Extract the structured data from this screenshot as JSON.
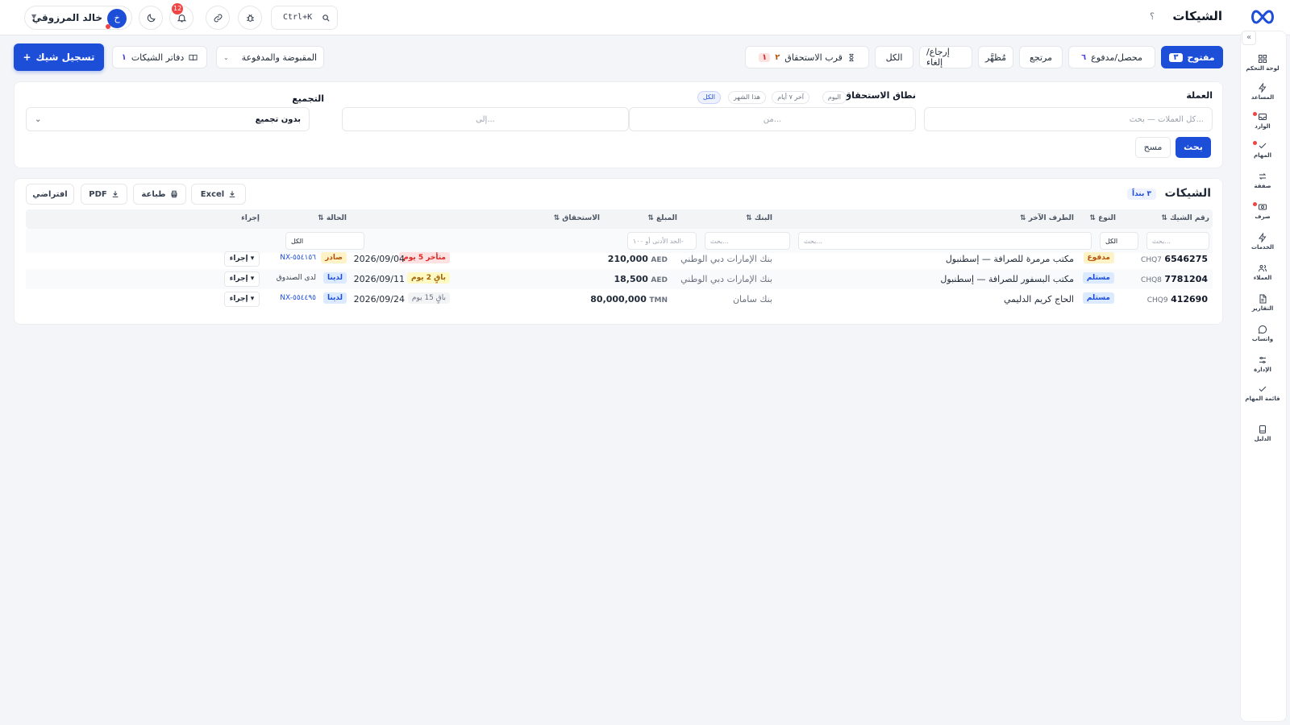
{
  "app": {
    "page_title": "الشيكات",
    "help_glyph": "؟",
    "user_name": "خالد المرزوقي",
    "user_initial": "خ",
    "notifications_count": "12",
    "search_shortcut": "Ctrl+K",
    "brand_color": "#1d4ed8"
  },
  "sidebar": {
    "collapse_glyph": "«",
    "items": [
      {
        "label": "لوحة التحكم",
        "icon": "grid-icon"
      },
      {
        "label": "المساعد",
        "icon": "lightning-icon"
      },
      {
        "label": "الوارد",
        "icon": "inbox-icon"
      },
      {
        "label": "المهام",
        "icon": "check-icon"
      },
      {
        "label": "صفقة",
        "icon": "transfer-icon"
      },
      {
        "label": "صرف",
        "icon": "cash-icon"
      },
      {
        "label": "الخدمات",
        "icon": "lightning-icon"
      },
      {
        "label": "العملاء",
        "icon": "users-icon"
      },
      {
        "label": "التقارير",
        "icon": "report-icon"
      },
      {
        "label": "واتساب",
        "icon": "chat-icon"
      },
      {
        "label": "الإدارة",
        "icon": "sliders-icon"
      },
      {
        "label": "قائمة المهام",
        "icon": "check-icon"
      },
      {
        "label": "الدليل",
        "icon": "book-icon"
      }
    ]
  },
  "toolbar": {
    "register_label": "تسجيل شيك",
    "register_glyph": "+",
    "books_label": "دفاتر الشيكات",
    "books_count": "١",
    "view_select": "المقبوضة والمدفوعة",
    "tabs": [
      {
        "label": "مفتوح",
        "count": "٣"
      },
      {
        "label": "محصل/مدفوع",
        "count": "٦"
      },
      {
        "label": "مرتجع",
        "count": ""
      },
      {
        "label": "مُظهَّر",
        "count": ""
      },
      {
        "label": "إرجاع/إلغاء",
        "count": ""
      },
      {
        "label": "الكل",
        "count": ""
      },
      {
        "label": "قرب الاستحقاق",
        "count": "٢",
        "count_alt": "١"
      }
    ]
  },
  "filters": {
    "currency_label": "العملة",
    "currency_placeholder": "كل العملات — بحث...",
    "due_range_label": "نطاق الاستحقاق",
    "chips": [
      "اليوم",
      "آخر ٧ أيام",
      "هذا الشهر",
      "الكل"
    ],
    "from_placeholder": "من...",
    "to_placeholder": "إلى...",
    "group_label": "التجميع",
    "group_value": "بدون تجميع",
    "search_btn": "بحث",
    "clear_btn": "مسح"
  },
  "table": {
    "title": "الشيكات",
    "count_badge": "٣ بنداً",
    "export_excel": "Excel",
    "export_print": "طباعة",
    "export_pdf": "PDF",
    "export_default": "افتراضي",
    "headers": {
      "cheque_no": "رقم الشيك",
      "type": "النوع",
      "party": "الطرف الآخر",
      "bank": "البنك",
      "amount": "المبلغ",
      "due": "الاستحقاق",
      "status": "الحالة",
      "action": "إجراء",
      "sort_glyph": "⇅"
    },
    "filter_row": {
      "cheque_search": "بحث...",
      "type_value": "الكل",
      "party_search": "بحث...",
      "bank_search": "بحث...",
      "amount_min": "الحد الأدنى أو ١٠٠-",
      "status_value": "الكل"
    },
    "rows": [
      {
        "prefix": "CHQ7",
        "number": "6546275",
        "type": "مدفوع",
        "party": "مكتب مرمرة للصرافة — إسطنبول",
        "bank": "بنك الإمارات دبي الوطني",
        "currency": "AED",
        "amount": "210,000",
        "due_badge": "متأخر 5 يوم",
        "due_date": "2026/09/04",
        "status": "صادر",
        "ref": "NX-٥٥٤١٥٦",
        "action": "إجراء ▾"
      },
      {
        "prefix": "CHQ8",
        "number": "7781204",
        "type": "مستلم",
        "party": "مكتب البسفور للصرافة — إسطنبول",
        "bank": "بنك الإمارات دبي الوطني",
        "currency": "AED",
        "amount": "18,500",
        "due_badge": "باقٍ 2 يوم",
        "due_date": "2026/09/11",
        "status": "لدينا",
        "ref": "لدى الصندوق",
        "action": "إجراء ▾"
      },
      {
        "prefix": "CHQ9",
        "number": "412690",
        "type": "مستلم",
        "party": "الحاج كريم الدليمي",
        "bank": "بنك سامان",
        "currency": "TMN",
        "amount": "80,000,000",
        "due_badge": "باقٍ 15 يوم",
        "due_date": "2026/09/24",
        "status": "لدينا",
        "ref": "NX-٥٥٤٤٩٥",
        "action": "إجراء ▾"
      }
    ]
  }
}
